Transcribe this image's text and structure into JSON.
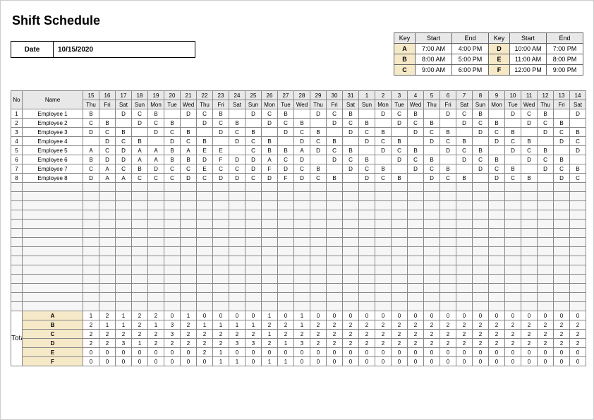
{
  "title": "Shift Schedule",
  "date": {
    "label": "Date",
    "value": "10/15/2020"
  },
  "key_table": {
    "headers": [
      "Key",
      "Start",
      "End",
      "Key",
      "Start",
      "End"
    ],
    "rows": [
      [
        "A",
        "7:00 AM",
        "4:00 PM",
        "D",
        "10:00 AM",
        "7:00 PM"
      ],
      [
        "B",
        "8:00 AM",
        "5:00 PM",
        "E",
        "11:00 AM",
        "8:00 PM"
      ],
      [
        "C",
        "9:00 AM",
        "6:00 PM",
        "F",
        "12:00 PM",
        "9:00 PM"
      ]
    ]
  },
  "columns": {
    "no_label": "No",
    "name_label": "Name"
  },
  "days": [
    {
      "num": "15",
      "dow": "Thu"
    },
    {
      "num": "16",
      "dow": "Fri"
    },
    {
      "num": "17",
      "dow": "Sat"
    },
    {
      "num": "18",
      "dow": "Sun"
    },
    {
      "num": "19",
      "dow": "Mon"
    },
    {
      "num": "20",
      "dow": "Tue"
    },
    {
      "num": "21",
      "dow": "Wed"
    },
    {
      "num": "22",
      "dow": "Thu"
    },
    {
      "num": "23",
      "dow": "Fri"
    },
    {
      "num": "24",
      "dow": "Sat"
    },
    {
      "num": "25",
      "dow": "Sun"
    },
    {
      "num": "26",
      "dow": "Mon"
    },
    {
      "num": "27",
      "dow": "Tue"
    },
    {
      "num": "28",
      "dow": "Wed"
    },
    {
      "num": "29",
      "dow": "Thu"
    },
    {
      "num": "30",
      "dow": "Fri"
    },
    {
      "num": "31",
      "dow": "Sat"
    },
    {
      "num": "1",
      "dow": "Sun"
    },
    {
      "num": "2",
      "dow": "Mon"
    },
    {
      "num": "3",
      "dow": "Tue"
    },
    {
      "num": "4",
      "dow": "Wed"
    },
    {
      "num": "5",
      "dow": "Thu"
    },
    {
      "num": "6",
      "dow": "Fri"
    },
    {
      "num": "7",
      "dow": "Sat"
    },
    {
      "num": "8",
      "dow": "Sun"
    },
    {
      "num": "9",
      "dow": "Mon"
    },
    {
      "num": "10",
      "dow": "Tue"
    },
    {
      "num": "11",
      "dow": "Wed"
    },
    {
      "num": "12",
      "dow": "Thu"
    },
    {
      "num": "13",
      "dow": "Fri"
    },
    {
      "num": "14",
      "dow": "Sat"
    }
  ],
  "employees": [
    {
      "no": "1",
      "name": "Employee 1",
      "shifts": [
        "B",
        "",
        "D",
        "C",
        "B",
        "",
        "D",
        "C",
        "B",
        "",
        "D",
        "C",
        "B",
        "",
        "D",
        "C",
        "B",
        "",
        "D",
        "C",
        "B",
        "",
        "D",
        "C",
        "B",
        "",
        "D",
        "C",
        "B",
        "",
        "D"
      ]
    },
    {
      "no": "2",
      "name": "Employee 2",
      "shifts": [
        "C",
        "B",
        "",
        "D",
        "C",
        "B",
        "",
        "D",
        "C",
        "B",
        "",
        "D",
        "C",
        "B",
        "",
        "D",
        "C",
        "B",
        "",
        "D",
        "C",
        "B",
        "",
        "D",
        "C",
        "B",
        "",
        "D",
        "C",
        "B",
        ""
      ]
    },
    {
      "no": "3",
      "name": "Employee 3",
      "shifts": [
        "D",
        "C",
        "B",
        "",
        "D",
        "C",
        "B",
        "",
        "D",
        "C",
        "B",
        "",
        "D",
        "C",
        "B",
        "",
        "D",
        "C",
        "B",
        "",
        "D",
        "C",
        "B",
        "",
        "D",
        "C",
        "B",
        "",
        "D",
        "C",
        "B"
      ]
    },
    {
      "no": "4",
      "name": "Employee 4",
      "shifts": [
        "",
        "D",
        "C",
        "B",
        "",
        "D",
        "C",
        "B",
        "",
        "D",
        "C",
        "B",
        "",
        "D",
        "C",
        "B",
        "",
        "D",
        "C",
        "B",
        "",
        "D",
        "C",
        "B",
        "",
        "D",
        "C",
        "B",
        "",
        "D",
        "C"
      ]
    },
    {
      "no": "5",
      "name": "Employee 5",
      "shifts": [
        "A",
        "C",
        "D",
        "A",
        "A",
        "B",
        "A",
        "E",
        "E",
        "",
        "C",
        "B",
        "B",
        "A",
        "D",
        "C",
        "B",
        "",
        "D",
        "C",
        "B",
        "",
        "D",
        "C",
        "B",
        "",
        "D",
        "C",
        "B",
        "",
        "D"
      ]
    },
    {
      "no": "6",
      "name": "Employee 6",
      "shifts": [
        "B",
        "D",
        "D",
        "A",
        "A",
        "B",
        "B",
        "D",
        "F",
        "D",
        "D",
        "A",
        "C",
        "D",
        "",
        "D",
        "C",
        "B",
        "",
        "D",
        "C",
        "B",
        "",
        "D",
        "C",
        "B",
        "",
        "D",
        "C",
        "B",
        ""
      ]
    },
    {
      "no": "7",
      "name": "Employee 7",
      "shifts": [
        "C",
        "A",
        "C",
        "B",
        "D",
        "C",
        "C",
        "E",
        "C",
        "C",
        "D",
        "F",
        "D",
        "C",
        "B",
        "",
        "D",
        "C",
        "B",
        "",
        "D",
        "C",
        "B",
        "",
        "D",
        "C",
        "B",
        "",
        "D",
        "C",
        "B"
      ]
    },
    {
      "no": "8",
      "name": "Employee 8",
      "shifts": [
        "D",
        "A",
        "A",
        "C",
        "C",
        "C",
        "D",
        "C",
        "D",
        "D",
        "C",
        "D",
        "F",
        "D",
        "C",
        "B",
        "",
        "D",
        "C",
        "B",
        "",
        "D",
        "C",
        "B",
        "",
        "D",
        "C",
        "B",
        "",
        "D",
        "C"
      ]
    }
  ],
  "empty_rows": 14,
  "totals": {
    "label": "Total",
    "rows": [
      {
        "key": "A",
        "vals": [
          "1",
          "2",
          "1",
          "2",
          "2",
          "0",
          "1",
          "0",
          "0",
          "0",
          "0",
          "1",
          "0",
          "1",
          "0",
          "0",
          "0",
          "0",
          "0",
          "0",
          "0",
          "0",
          "0",
          "0",
          "0",
          "0",
          "0",
          "0",
          "0",
          "0",
          "0"
        ]
      },
      {
        "key": "B",
        "vals": [
          "2",
          "1",
          "1",
          "2",
          "1",
          "3",
          "2",
          "1",
          "1",
          "1",
          "1",
          "2",
          "2",
          "1",
          "2",
          "2",
          "2",
          "2",
          "2",
          "2",
          "2",
          "2",
          "2",
          "2",
          "2",
          "2",
          "2",
          "2",
          "2",
          "2",
          "2"
        ]
      },
      {
        "key": "C",
        "vals": [
          "2",
          "2",
          "2",
          "2",
          "2",
          "3",
          "2",
          "2",
          "2",
          "2",
          "2",
          "1",
          "2",
          "2",
          "2",
          "2",
          "2",
          "2",
          "2",
          "2",
          "2",
          "2",
          "2",
          "2",
          "2",
          "2",
          "2",
          "2",
          "2",
          "2",
          "2"
        ]
      },
      {
        "key": "D",
        "vals": [
          "2",
          "2",
          "3",
          "1",
          "2",
          "2",
          "2",
          "2",
          "2",
          "3",
          "3",
          "2",
          "1",
          "3",
          "2",
          "2",
          "2",
          "2",
          "2",
          "2",
          "2",
          "2",
          "2",
          "2",
          "2",
          "2",
          "2",
          "2",
          "2",
          "2",
          "2"
        ]
      },
      {
        "key": "E",
        "vals": [
          "0",
          "0",
          "0",
          "0",
          "0",
          "0",
          "0",
          "2",
          "1",
          "0",
          "0",
          "0",
          "0",
          "0",
          "0",
          "0",
          "0",
          "0",
          "0",
          "0",
          "0",
          "0",
          "0",
          "0",
          "0",
          "0",
          "0",
          "0",
          "0",
          "0",
          "0"
        ]
      },
      {
        "key": "F",
        "vals": [
          "0",
          "0",
          "0",
          "0",
          "0",
          "0",
          "0",
          "0",
          "1",
          "1",
          "0",
          "1",
          "1",
          "0",
          "0",
          "0",
          "0",
          "0",
          "0",
          "0",
          "0",
          "0",
          "0",
          "0",
          "0",
          "0",
          "0",
          "0",
          "0",
          "0",
          "0"
        ]
      }
    ]
  }
}
